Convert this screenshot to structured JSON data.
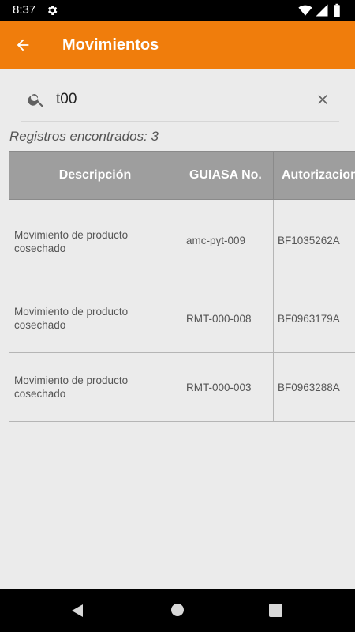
{
  "status_bar": {
    "time": "8:37",
    "icons": [
      "settings-gear-icon",
      "wifi-icon",
      "signal-icon",
      "battery-icon"
    ]
  },
  "app_bar": {
    "title": "Movimientos",
    "back_icon": "arrow-back-icon",
    "color": "#f07d0c"
  },
  "search": {
    "value": "t00",
    "icon": "search-icon",
    "clear_icon": "close-icon"
  },
  "results": {
    "count_label": "Registros encontrados: 3"
  },
  "table": {
    "columns": [
      "Descripción",
      "GUIASA No.",
      "Autorizacion"
    ],
    "rows": [
      {
        "descripcion": "Movimiento de producto cosechado",
        "guia": "amc-pyt-009",
        "autorizacion": "BF1035262A"
      },
      {
        "descripcion": "Movimiento de producto cosechado",
        "guia": "RMT-000-008",
        "autorizacion": "BF0963179A"
      },
      {
        "descripcion": "Movimiento de producto cosechado",
        "guia": "RMT-000-003",
        "autorizacion": "BF0963288A"
      }
    ]
  },
  "nav_bar": {
    "icons": [
      "nav-back-icon",
      "nav-home-icon",
      "nav-recents-icon"
    ]
  }
}
